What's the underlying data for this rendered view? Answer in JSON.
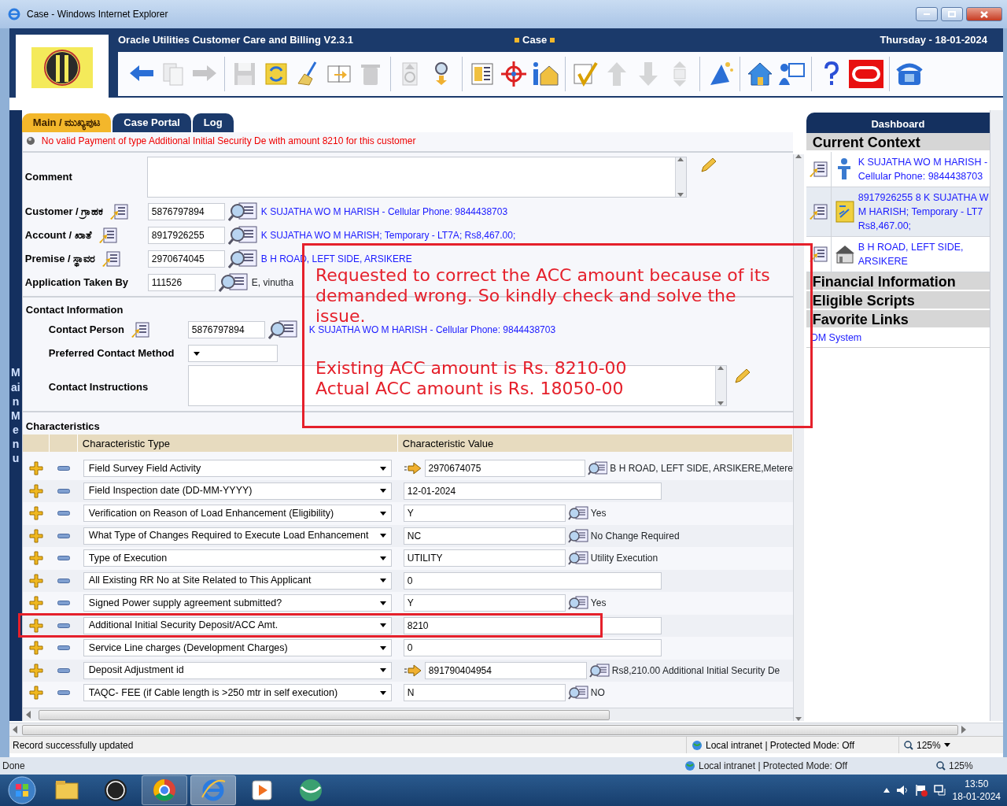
{
  "window": {
    "title": "Case - Windows Internet Explorer"
  },
  "app": {
    "title": "Oracle Utilities Customer Care and Billing V2.3.1",
    "page": "Case",
    "date": "Thursday - 18-01-2024"
  },
  "toolbar": [
    {
      "disabled": false
    },
    {
      "disabled": true
    },
    {
      "disabled": true
    },
    {
      "disabled": true
    },
    {
      "disabled": false
    },
    {
      "disabled": false
    },
    {
      "disabled": false
    },
    {
      "disabled": true
    },
    {
      "disabled": true
    },
    {
      "disabled": false
    },
    {
      "disabled": false
    },
    {
      "disabled": false
    },
    {
      "disabled": false
    },
    {
      "disabled": false
    },
    {
      "disabled": true
    },
    {
      "disabled": true
    },
    {
      "disabled": true
    },
    {
      "disabled": false
    },
    {
      "disabled": false
    },
    {
      "disabled": false
    },
    {
      "disabled": false
    },
    {
      "disabled": false
    },
    {
      "disabled": false
    }
  ],
  "main_menu": {
    "label": "Main Menu"
  },
  "tabs": [
    {
      "label": "Main / ಮುಖ್ಯಪುಟ",
      "selected": true
    },
    {
      "label": "Case Portal",
      "selected": false
    },
    {
      "label": "Log",
      "selected": false
    }
  ],
  "message": "No valid Payment of type Additional Initial Security De with amount 8210 for this customer",
  "comment": {
    "label": "Comment"
  },
  "fields": [
    {
      "kind": "context",
      "label": "Customer / ಗ್ರಾಹಕ",
      "value": "5876797894",
      "description": "K SUJATHA WO M HARISH - Cellular Phone: 9844438703"
    },
    {
      "kind": "context",
      "label": "Account / ಖಾತೆ",
      "value": "8917926255",
      "description": "K SUJATHA WO M HARISH; Temporary - LT7A; Rs8,467.00;"
    },
    {
      "kind": "context",
      "label": "Premise / ಸ್ಥಾವರ",
      "value": "2970674045",
      "description": "B H ROAD, LEFT SIDE, ARSIKERE"
    },
    {
      "kind": "plain",
      "label": "Application Taken By",
      "value": "111526",
      "description": "E, vinutha"
    }
  ],
  "contact": {
    "title": "Contact Information",
    "person": {
      "label": "Contact Person",
      "value": "5876797894",
      "description": "K SUJATHA WO M HARISH - Cellular Phone: 9844438703"
    },
    "method": {
      "label": "Preferred Contact Method"
    },
    "instructions": {
      "label": "Contact Instructions"
    }
  },
  "characteristics": {
    "title": "Characteristics",
    "columns": [
      "Characteristic Type",
      "Characteristic Value"
    ],
    "rows": [
      {
        "kind": "fk",
        "type": "Field Survey Field Activity",
        "value": "2970674075",
        "description": "B H ROAD, LEFT SIDE, ARSIKERE,Metere",
        "highlighted": false
      },
      {
        "kind": "plain",
        "type": "Field Inspection date (DD-MM-YYYY)",
        "value": "12-01-2024",
        "highlighted": false
      },
      {
        "kind": "lookup",
        "type": "Verification on Reason of Load Enhancement (Eligibility)",
        "value": "Y",
        "description": "Yes",
        "highlighted": false
      },
      {
        "kind": "lookup",
        "type": "What Type of Changes Required to Execute Load Enhancement",
        "value": "NC",
        "description": "No Change Required",
        "highlighted": false
      },
      {
        "kind": "lookup",
        "type": "Type of Execution",
        "value": "UTILITY",
        "description": "Utility Execution",
        "highlighted": false
      },
      {
        "kind": "plain",
        "type": "All Existing RR No at Site Related to This Applicant",
        "value": "0",
        "highlighted": false
      },
      {
        "kind": "lookup",
        "type": "Signed Power supply agreement submitted?",
        "value": "Y",
        "description": "Yes",
        "highlighted": false
      },
      {
        "kind": "plain",
        "type": "Additional Initial Security Deposit/ACC Amt.",
        "value": "8210",
        "highlighted": true
      },
      {
        "kind": "plain",
        "type": "Service Line charges (Development Charges)",
        "value": "0",
        "highlighted": false
      },
      {
        "kind": "fk",
        "type": "Deposit Adjustment id",
        "value": "891790404954",
        "description": "Rs8,210.00 Additional Initial Security De",
        "highlighted": false
      },
      {
        "kind": "lookup",
        "type": "TAQC- FEE (if Cable length is >250 mtr in self execution)",
        "value": "N",
        "description": "NO",
        "highlighted": false
      }
    ]
  },
  "dashboard": {
    "title": "Dashboard",
    "current_context": {
      "title": "Current Context",
      "items": [
        {
          "kind": "person",
          "lines": [
            "K SUJATHA WO M HARISH -",
            "Cellular Phone: 9844438703"
          ]
        },
        {
          "kind": "account",
          "lines": [
            "8917926255 8 K SUJATHA W",
            "M HARISH; Temporary - LT7",
            "Rs8,467.00;"
          ]
        },
        {
          "kind": "premise",
          "lines": [
            "B H ROAD, LEFT SIDE,",
            "ARSIKERE"
          ]
        }
      ]
    },
    "sections": [
      "Financial Information",
      "Eligible Scripts",
      "Favorite Links"
    ],
    "favorite_links": [
      "DM System"
    ]
  },
  "annotation": {
    "paragraphs": [
      "Requested to correct the ACC amount because of its demanded wrong. So kindly check and solve the issue.",
      "Existing ACC amount is Rs. 8210-00",
      "Actual ACC amount is Rs. 18050-00"
    ]
  },
  "status_bar": {
    "text": "Record successfully updated",
    "zone": "Local intranet | Protected Mode: Off",
    "zoom": "125%"
  },
  "outer_status": {
    "text": "Done",
    "zone": "Local intranet | Protected Mode: Off",
    "zoom": "125%"
  },
  "taskbar": {
    "apps": [
      {
        "kind": "explorer",
        "running": false,
        "selected": false
      },
      {
        "kind": "hp",
        "running": false,
        "selected": false
      },
      {
        "kind": "chrome",
        "running": true,
        "selected": false
      },
      {
        "kind": "ie",
        "running": true,
        "selected": true
      },
      {
        "kind": "media",
        "running": false,
        "selected": false
      },
      {
        "kind": "globe",
        "running": false,
        "selected": false
      }
    ],
    "time": "13:50",
    "date": "18-01-2024"
  }
}
